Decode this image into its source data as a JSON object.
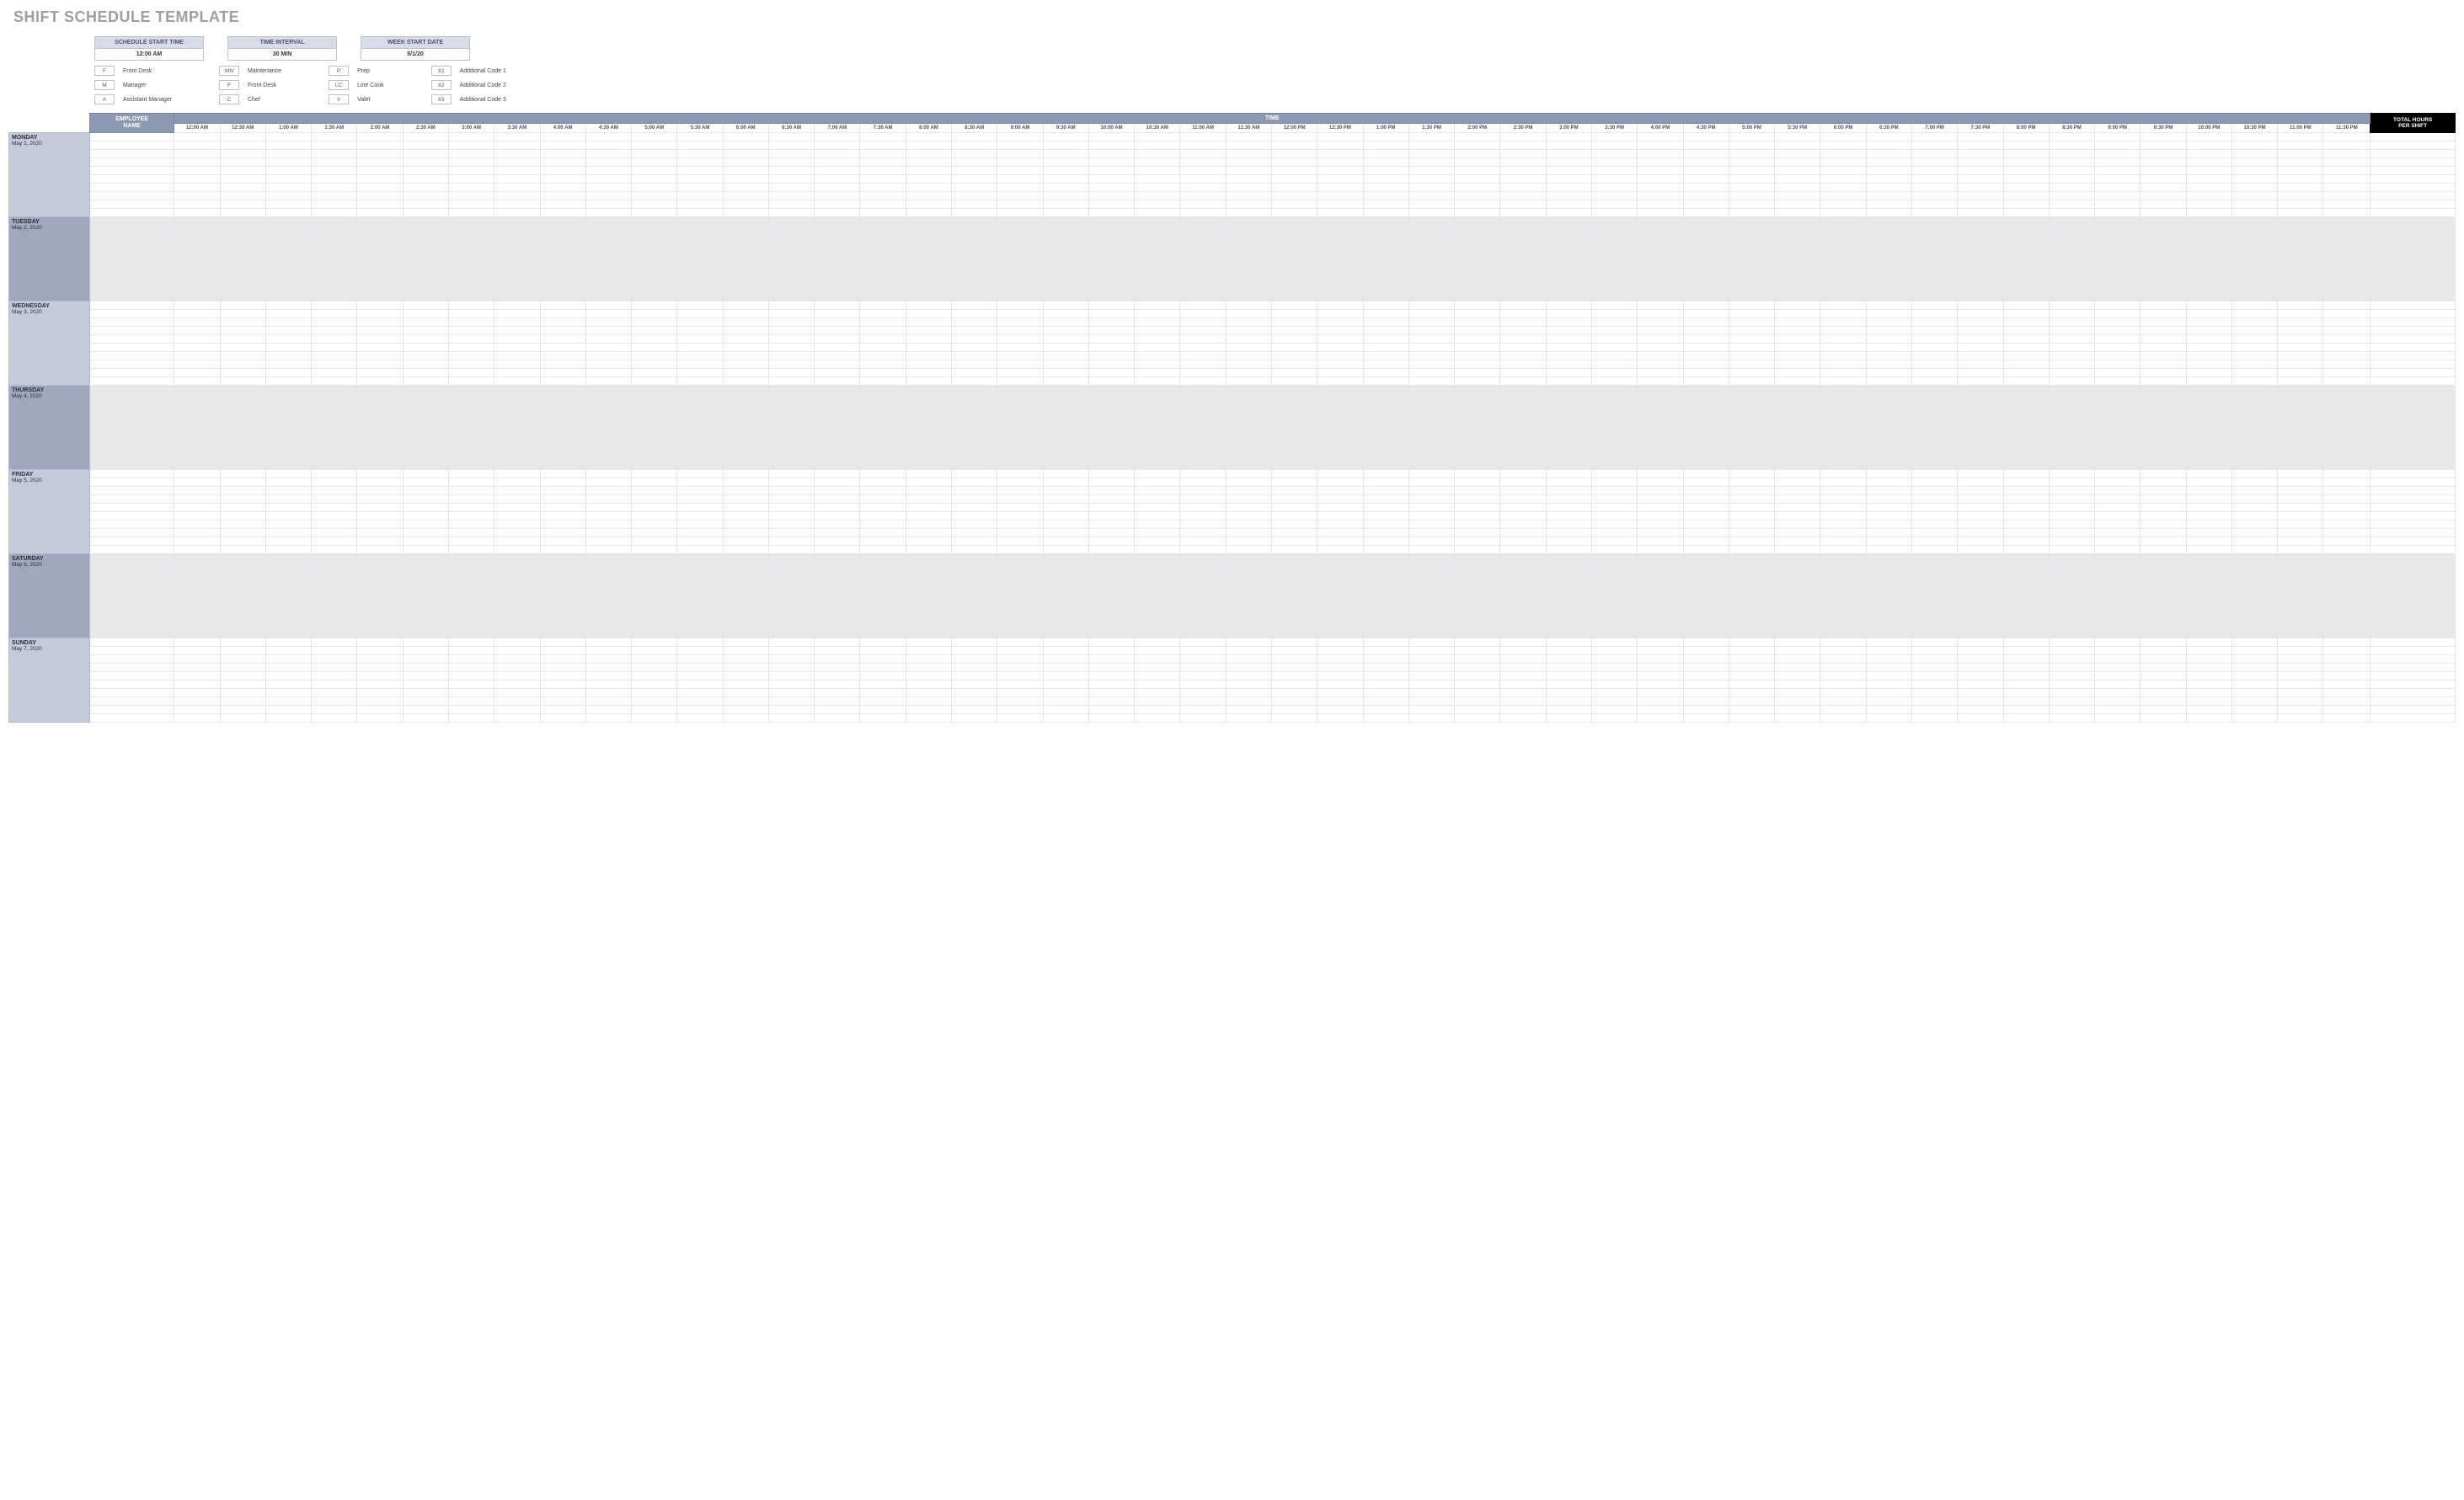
{
  "title": "SHIFT SCHEDULE TEMPLATE",
  "config": {
    "start_time": {
      "label": "SCHEDULE START TIME",
      "value": "12:00 AM"
    },
    "interval": {
      "label": "TIME INTERVAL",
      "value": "30 MIN"
    },
    "week_start": {
      "label": "WEEK START DATE",
      "value": "5/1/20"
    }
  },
  "legend": [
    {
      "code": "F",
      "label": "Front Desk"
    },
    {
      "code": "M",
      "label": "Manager"
    },
    {
      "code": "A",
      "label": "Assistant Manager"
    },
    {
      "code": "MN",
      "label": "Maintenance"
    },
    {
      "code": "F",
      "label": "Front Desk"
    },
    {
      "code": "C",
      "label": "Chef"
    },
    {
      "code": "P",
      "label": "Prep"
    },
    {
      "code": "LC",
      "label": "Line Cook"
    },
    {
      "code": "V",
      "label": "Valet"
    },
    {
      "code": "X1",
      "label": "Additional Code 1"
    },
    {
      "code": "X2",
      "label": "Additional Code 2"
    },
    {
      "code": "X3",
      "label": "Additional Code 3"
    }
  ],
  "headers": {
    "employee_name": "EMPLOYEE NAME",
    "time": "TIME",
    "total_hours": "TOTAL HOURS PER SHIFT"
  },
  "time_slots": [
    "12:00 AM",
    "12:30 AM",
    "1:00 AM",
    "1:30 AM",
    "2:00 AM",
    "2:30 AM",
    "3:00 AM",
    "3:30 AM",
    "4:00 AM",
    "4:30 AM",
    "5:00 AM",
    "5:30 AM",
    "6:00 AM",
    "6:30 AM",
    "7:00 AM",
    "7:30 AM",
    "8:00 AM",
    "8:30 AM",
    "9:00 AM",
    "9:30 AM",
    "10:00 AM",
    "10:30 AM",
    "11:00 AM",
    "11:30 AM",
    "12:00 PM",
    "12:30 PM",
    "1:00 PM",
    "1:30 PM",
    "2:00 PM",
    "2:30 PM",
    "3:00 PM",
    "3:30 PM",
    "4:00 PM",
    "4:30 PM",
    "5:00 PM",
    "5:30 PM",
    "6:00 PM",
    "6:30 PM",
    "7:00 PM",
    "7:30 PM",
    "8:00 PM",
    "8:30 PM",
    "9:00 PM",
    "9:30 PM",
    "10:00 PM",
    "10:30 PM",
    "11:00 PM",
    "11:30 PM"
  ],
  "days": [
    {
      "name": "MONDAY",
      "date": "May 1, 2020",
      "shaded": false
    },
    {
      "name": "TUESDAY",
      "date": "May 2, 2020",
      "shaded": true
    },
    {
      "name": "WEDNESDAY",
      "date": "May 3, 2020",
      "shaded": false
    },
    {
      "name": "THURSDAY",
      "date": "May 4, 2020",
      "shaded": true
    },
    {
      "name": "FRIDAY",
      "date": "May 5, 2020",
      "shaded": false
    },
    {
      "name": "SATURDAY",
      "date": "May 6, 2020",
      "shaded": true
    },
    {
      "name": "SUNDAY",
      "date": "May 7, 2020",
      "shaded": false
    }
  ],
  "rows_per_day": 10
}
